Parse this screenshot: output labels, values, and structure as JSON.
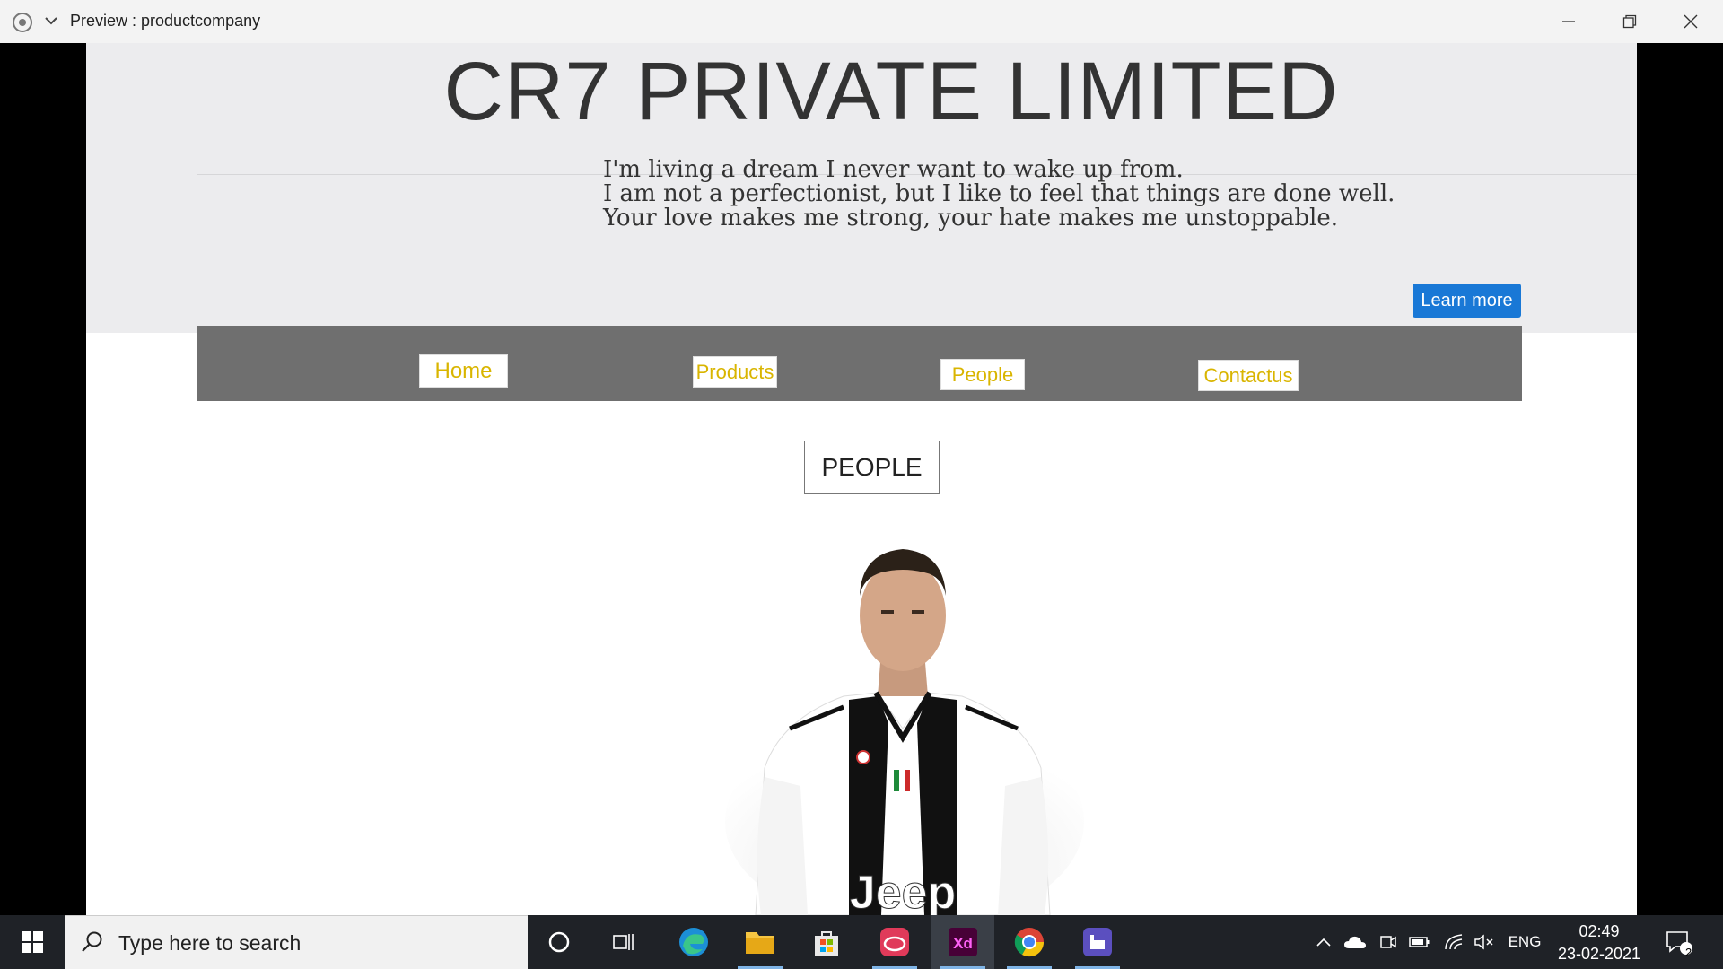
{
  "window": {
    "title": "Preview : productcompany"
  },
  "hero": {
    "title": "CR7 PRIVATE LIMITED",
    "quotes": [
      "I'm living a dream I never want to wake up from.",
      "I am not a perfectionist, but I like to feel that things are done well.",
      "Your love makes me strong, your hate makes me unstoppable."
    ],
    "learn_more_label": "Learn more"
  },
  "nav": {
    "items": [
      "Home",
      "Products",
      "People",
      "Contactus"
    ]
  },
  "section": {
    "heading": "PEOPLE"
  },
  "portrait": {
    "jersey_text": "Jeep"
  },
  "taskbar": {
    "search_placeholder": "Type here to search",
    "apps": [
      "cortana-icon",
      "task-view-icon",
      "edge-icon",
      "file-explorer-icon",
      "store-icon",
      "creative-cloud-icon",
      "adobe-xd-icon",
      "chrome-icon",
      "app-icon"
    ],
    "xd_label": "Xd",
    "language": "ENG",
    "time": "02:49",
    "date": "23-02-2021",
    "notification_count": "2"
  },
  "colors": {
    "accent_button": "#1978d6",
    "nav_bar": "#6f6f6f",
    "nav_text": "#d9b500",
    "hero_bg": "#ececee"
  }
}
